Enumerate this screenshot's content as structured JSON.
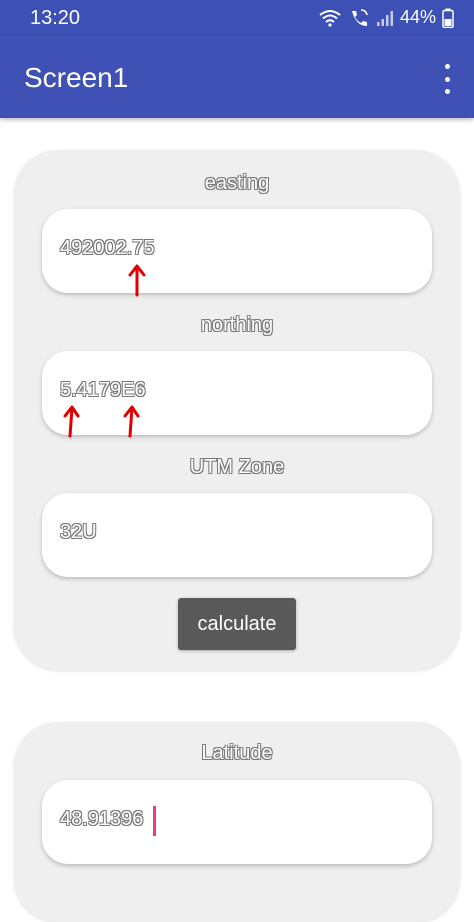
{
  "status_bar": {
    "time": "13:20",
    "battery": "44%"
  },
  "app_bar": {
    "title": "Screen1"
  },
  "form": {
    "easting": {
      "label": "easting",
      "value": "492002.75"
    },
    "northing": {
      "label": "northing",
      "value": "5.4179E6"
    },
    "utm_zone": {
      "label": "UTM Zone",
      "value": "32U"
    },
    "calculate_label": "calculate"
  },
  "results": {
    "latitude": {
      "label": "Latitude",
      "value": "48.91396"
    }
  },
  "colors": {
    "primary": "#3f51b5",
    "status_bar": "#3d50b6",
    "annotation": "#e00000",
    "cursor": "#e53e8a"
  }
}
